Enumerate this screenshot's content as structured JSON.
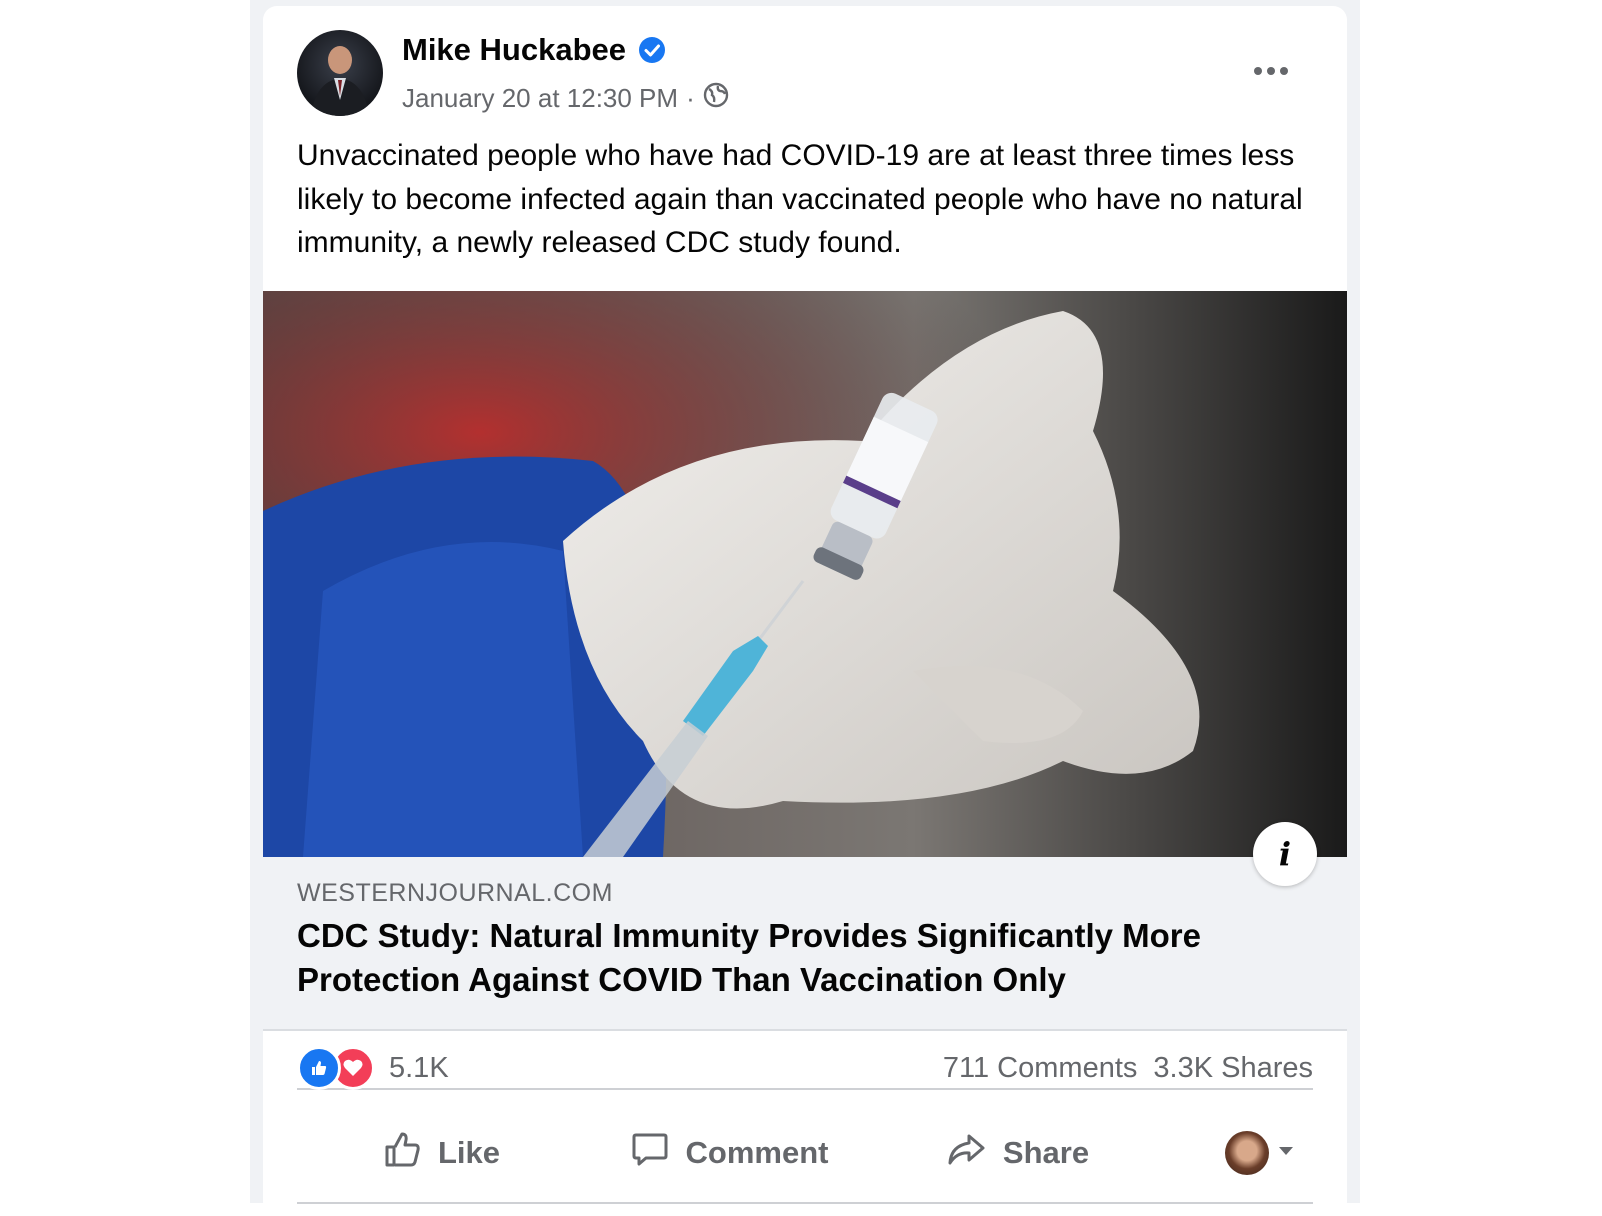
{
  "post": {
    "author": "Mike Huckabee",
    "timestamp": "January 20 at 12:30 PM",
    "separator": "·",
    "text": "Unvaccinated people who have had COVID-19 are at least three times less likely to become infected again than vaccinated people who have no natural immunity, a newly released CDC study found."
  },
  "link": {
    "domain": "WESTERNJOURNAL.COM",
    "headline": "CDC Study: Natural Immunity Provides Significantly More Protection Against COVID Than Vaccination Only",
    "info_glyph": "i"
  },
  "stats": {
    "reactions_count": "5.1K",
    "comments": "711 Comments",
    "shares": "3.3K Shares"
  },
  "actions": {
    "like_label": "Like",
    "comment_label": "Comment",
    "share_label": "Share"
  },
  "colors": {
    "like_blue": "#1877f2",
    "love_red": "#f33e58",
    "verified_blue": "#1877f2",
    "secondary_text": "#65676b",
    "footer_bg": "#f0f2f5"
  },
  "icons": [
    "verified-badge-icon",
    "globe-icon",
    "more-options-icon",
    "info-icon",
    "like-reaction-icon",
    "love-reaction-icon",
    "thumbs-up-icon",
    "comment-icon",
    "share-arrow-icon",
    "chevron-down-icon"
  ]
}
